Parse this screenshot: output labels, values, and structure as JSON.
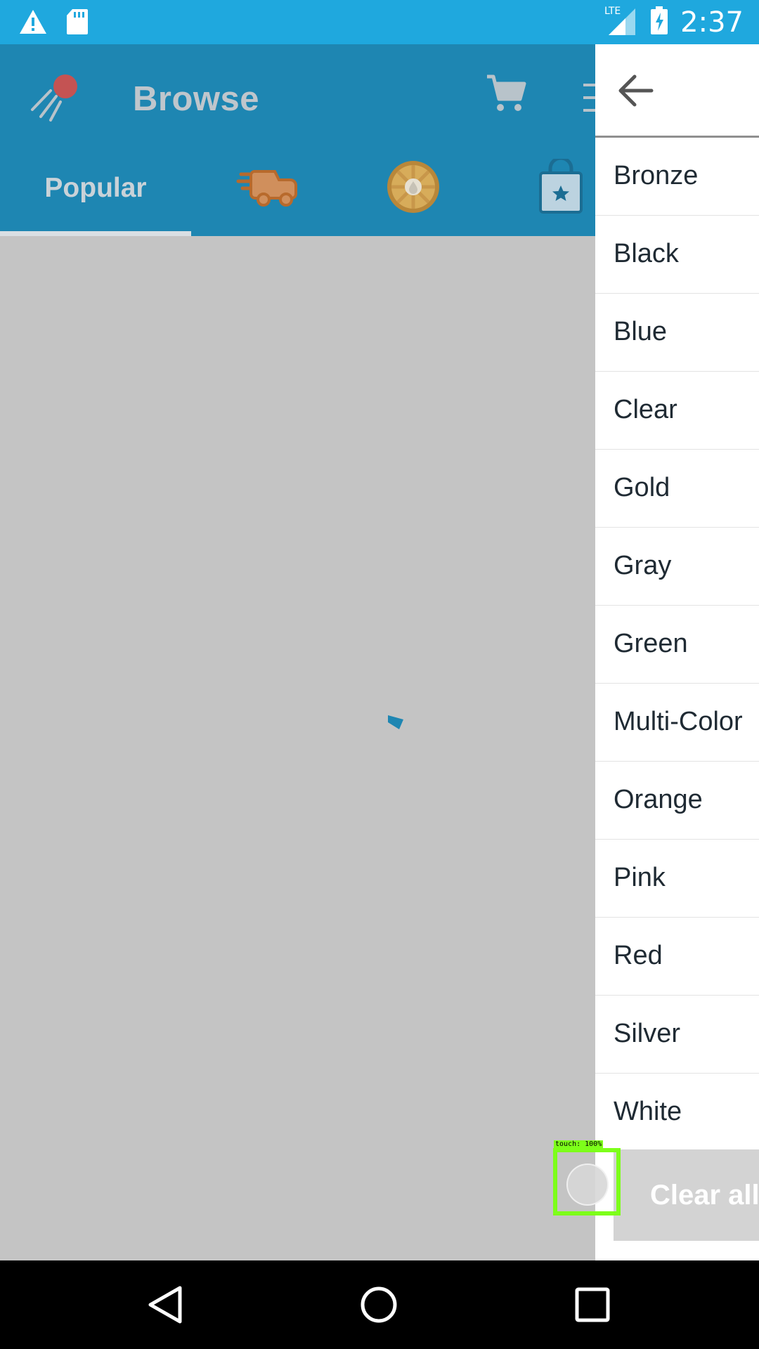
{
  "status_bar": {
    "time": "2:37",
    "network": "LTE",
    "icons": [
      "warning-icon",
      "sd-card-icon",
      "signal-icon",
      "battery-charging-icon"
    ]
  },
  "app_bar": {
    "title": "Browse",
    "icons": [
      "app-logo-icon",
      "cart-icon",
      "filter-icon"
    ]
  },
  "tabs": [
    {
      "label": "Popular",
      "selected": true
    },
    {
      "icon": "delivery-truck-icon"
    },
    {
      "icon": "coin-icon"
    },
    {
      "icon": "shopping-bag-icon"
    }
  ],
  "drawer": {
    "back_icon": "arrow-left-icon",
    "colors": [
      "Bronze",
      "Black",
      "Blue",
      "Clear",
      "Gold",
      "Gray",
      "Green",
      "Multi-Color",
      "Orange",
      "Pink",
      "Red",
      "Silver",
      "White"
    ],
    "clear_all_label": "Clear all"
  },
  "touch_overlay": {
    "label": "touch: 100%"
  },
  "nav_bar": {
    "icons": [
      "back-icon",
      "home-icon",
      "recents-icon"
    ]
  },
  "colors": {
    "status_bar": "#1fa8de",
    "app_bar": "#1e86b2",
    "scrim": "#c4c4c4",
    "touch_indicator": "#7dff1a"
  }
}
